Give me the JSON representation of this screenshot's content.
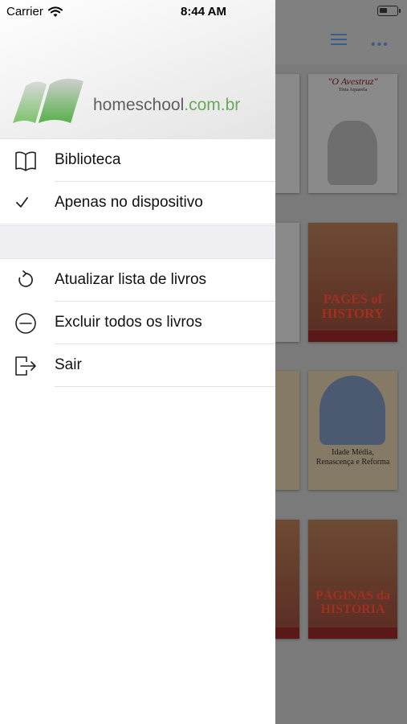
{
  "status_bar": {
    "carrier": "Carrier",
    "time": "8:44 AM"
  },
  "brand": {
    "name": "homeschool",
    "domain": ".com.br",
    "colors": {
      "green": "#6aa95a",
      "gray": "#5f5f5f"
    }
  },
  "menu": {
    "top_items": [
      {
        "label": "Biblioteca",
        "icon": "book-icon"
      },
      {
        "label": "Apenas no dispositivo",
        "icon": "checkmark-icon"
      }
    ],
    "bottom_items": [
      {
        "label": "Atualizar lista de livros",
        "icon": "refresh-icon"
      },
      {
        "label": "Excluir todos os livros",
        "icon": "minus-circle-icon"
      },
      {
        "label": "Sair",
        "icon": "logout-icon"
      }
    ]
  },
  "background": {
    "books": [
      {
        "title": "\"O Avestruz\"",
        "subtitle": "Tinta Aquarela"
      },
      {
        "title": "PAGES of HISTORY"
      },
      {
        "title": "Idade Média, Renascença e Reforma"
      },
      {
        "title": "PÁGINAS da HISTÓRIA"
      }
    ]
  }
}
